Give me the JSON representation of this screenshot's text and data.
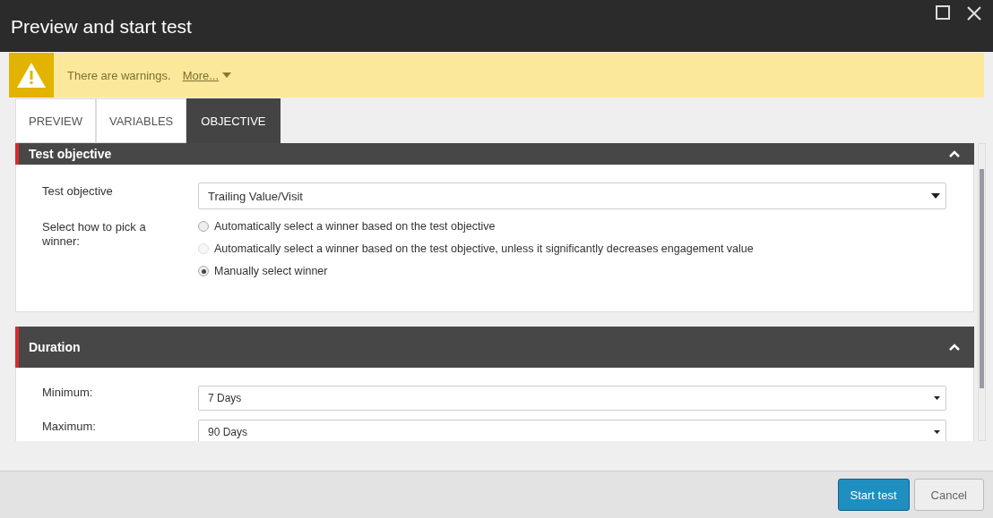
{
  "window": {
    "title": "Preview and start test"
  },
  "warning": {
    "message": "There are warnings.",
    "link": "More..."
  },
  "tabs": [
    {
      "label": "PREVIEW",
      "selected": false
    },
    {
      "label": "VARIABLES",
      "selected": false
    },
    {
      "label": "OBJECTIVE",
      "selected": true
    }
  ],
  "sections": [
    {
      "title": "Test objective",
      "expanded": true,
      "fields": [
        {
          "kind": "select",
          "label": "Test objective",
          "value": "Trailing Value/Visit"
        },
        {
          "kind": "radio",
          "label": "Select how to pick a winner:",
          "options": [
            {
              "label": "Automatically select a winner based on the test objective",
              "selected": false,
              "disabled": false
            },
            {
              "label": "Automatically select a winner based on the test objective, unless it significantly decreases engagement value",
              "selected": false,
              "disabled": true
            },
            {
              "label": "Manually select winner",
              "selected": true,
              "disabled": false
            }
          ]
        }
      ]
    },
    {
      "title": "Duration",
      "expanded": true,
      "fields": [
        {
          "kind": "select",
          "label": "Minimum:",
          "value": "7 Days"
        },
        {
          "kind": "select",
          "label": "Maximum:",
          "value": "90 Days"
        }
      ]
    }
  ],
  "buttons": [
    {
      "label": "Start test",
      "kind": "primary"
    },
    {
      "label": "Cancel",
      "kind": "secondary"
    }
  ]
}
